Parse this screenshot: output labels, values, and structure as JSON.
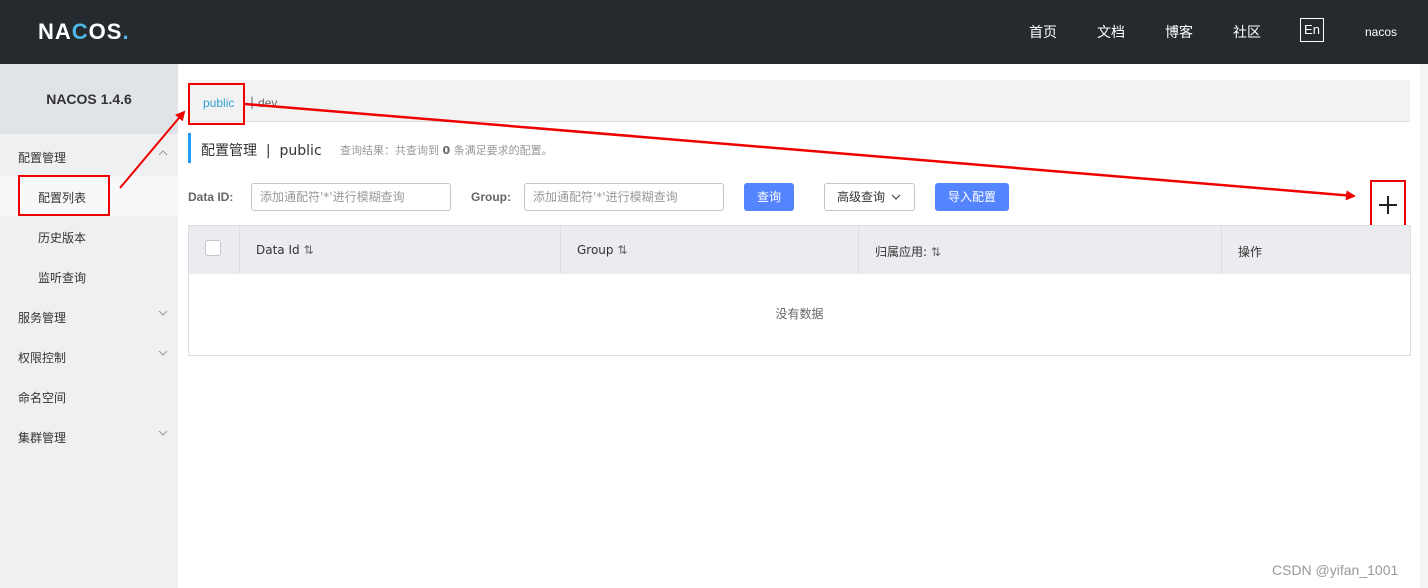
{
  "header": {
    "logo": {
      "part1": "NA",
      "part2": "C",
      "part3": "OS",
      "dot": "."
    },
    "nav": [
      "首页",
      "文档",
      "博客",
      "社区"
    ],
    "lang": "En",
    "user": "nacos"
  },
  "sidebar": {
    "version": "NACOS 1.4.6",
    "items": [
      {
        "label": "配置管理",
        "expanded": true
      },
      {
        "label": "配置列表"
      },
      {
        "label": "历史版本"
      },
      {
        "label": "监听查询"
      },
      {
        "label": "服务管理"
      },
      {
        "label": "权限控制"
      },
      {
        "label": "命名空间"
      },
      {
        "label": "集群管理"
      }
    ]
  },
  "namespaces": {
    "active": "public",
    "separator": "|",
    "other": "dev"
  },
  "page": {
    "title": "配置管理  |  public",
    "query_prefix": "查询结果：共查询到",
    "query_count": "0",
    "query_suffix": "条满足要求的配置。"
  },
  "search": {
    "dataid_label": "Data ID:",
    "dataid_placeholder": "添加通配符'*'进行模糊查询",
    "group_label": "Group:",
    "group_placeholder": "添加通配符'*'进行模糊查询",
    "query_button": "查询",
    "advanced_button": "高级查询",
    "import_button": "导入配置"
  },
  "add_button": "+",
  "table": {
    "columns": [
      "Data Id",
      "Group",
      "归属应用:",
      "操作"
    ],
    "sort_icon": "⇅",
    "empty_text": "没有数据"
  },
  "watermark": "CSDN @yifan_1001",
  "colors": {
    "topbar": "#252a2f",
    "accent": "#5584ff",
    "highlight": "#e00000",
    "link": "#2fa3d4"
  }
}
